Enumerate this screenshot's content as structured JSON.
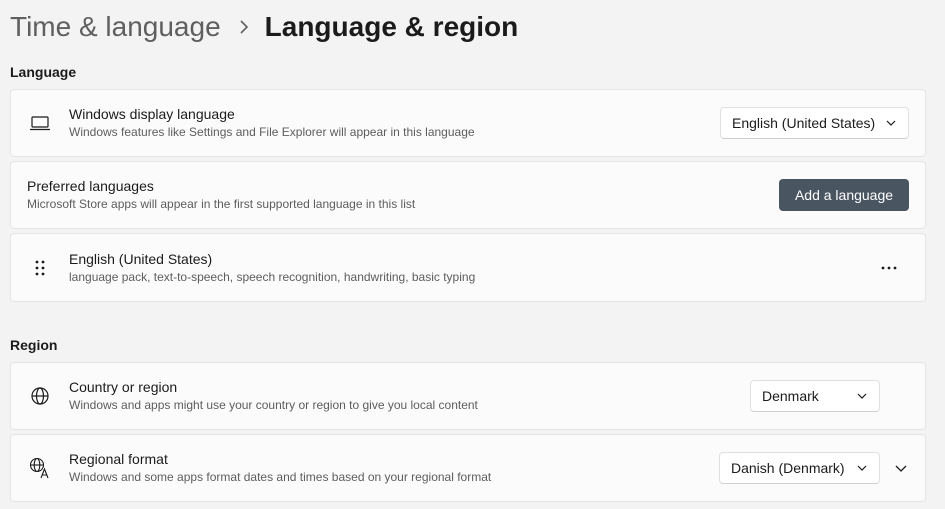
{
  "breadcrumb": {
    "parent": "Time & language",
    "current": "Language & region"
  },
  "language_section": {
    "title": "Language",
    "display_language": {
      "title": "Windows display language",
      "description": "Windows features like Settings and File Explorer will appear in this language",
      "selected": "English (United States)"
    },
    "preferred": {
      "title": "Preferred languages",
      "description": "Microsoft Store apps will appear in the first supported language in this list",
      "button_label": "Add a language"
    },
    "installed": [
      {
        "title": "English (United States)",
        "description": "language pack, text-to-speech, speech recognition, handwriting, basic typing"
      }
    ]
  },
  "region_section": {
    "title": "Region",
    "country": {
      "title": "Country or region",
      "description": "Windows and apps might use your country or region to give you local content",
      "selected": "Denmark"
    },
    "format": {
      "title": "Regional format",
      "description": "Windows and some apps format dates and times based on your regional format",
      "selected": "Danish (Denmark)"
    }
  },
  "colors": {
    "accent_button": "#4a5562",
    "background": "#f3f3f3",
    "card": "#fbfbfb"
  }
}
